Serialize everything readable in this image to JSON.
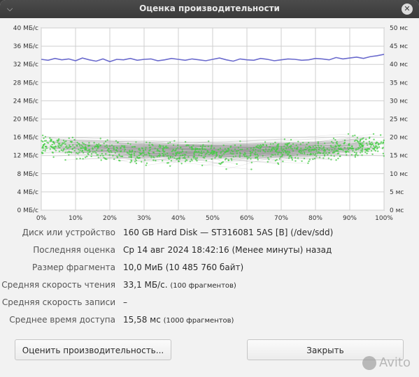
{
  "window": {
    "title": "Оценка производительности",
    "menu_icon": "chevron-down-icon",
    "close_icon": "close-icon"
  },
  "chart_data": {
    "type": "line",
    "x_ticks": [
      "0%",
      "10%",
      "20%",
      "30%",
      "40%",
      "50%",
      "60%",
      "70%",
      "80%",
      "90%",
      "100%"
    ],
    "y_left_ticks": [
      "0 МБ/с",
      "4 МБ/с",
      "8 МБ/с",
      "12 МБ/с",
      "16 МБ/с",
      "20 МБ/с",
      "24 МБ/с",
      "28 МБ/с",
      "32 МБ/с",
      "36 МБ/с",
      "40 МБ/с"
    ],
    "y_right_ticks": [
      "0 мс",
      "5 мс",
      "10 мс",
      "15 мс",
      "20 мс",
      "25 мс",
      "30 мс",
      "35 мс",
      "40 мс",
      "45 мс",
      "50 мс"
    ],
    "y_left_range": [
      0,
      40
    ],
    "y_right_range": [
      0,
      50
    ],
    "x_range": [
      0,
      100
    ],
    "grid": true,
    "read_rate_series": {
      "color": "#6a6acd",
      "x": [
        0,
        2,
        4,
        6,
        8,
        10,
        12,
        14,
        16,
        18,
        20,
        22,
        24,
        26,
        28,
        30,
        32,
        34,
        36,
        38,
        40,
        42,
        44,
        46,
        48,
        50,
        52,
        54,
        56,
        58,
        60,
        62,
        64,
        66,
        68,
        70,
        72,
        74,
        76,
        78,
        80,
        82,
        84,
        86,
        88,
        90,
        92,
        94,
        96,
        98,
        100
      ],
      "y": [
        33.1,
        32.9,
        33.3,
        33.0,
        33.2,
        32.8,
        33.4,
        33.0,
        32.7,
        33.2,
        32.6,
        33.1,
        33.0,
        33.3,
        32.9,
        33.1,
        33.2,
        32.8,
        33.0,
        33.3,
        33.1,
        32.9,
        33.2,
        33.0,
        32.8,
        33.1,
        33.4,
        33.0,
        32.7,
        33.2,
        33.0,
        32.9,
        33.3,
        33.1,
        32.8,
        33.0,
        33.2,
        33.1,
        32.9,
        33.0,
        33.3,
        33.2,
        33.0,
        33.5,
        33.2,
        33.4,
        33.6,
        33.3,
        33.7,
        33.9,
        34.2
      ]
    },
    "access_time_color": "#44cc44",
    "access_time_approx_mean_ms": 15.58
  },
  "info": {
    "rows": [
      {
        "label": "Диск или устройство",
        "value": "160 GB Hard Disk — ST316081 5AS [В] (/dev/sdd)",
        "note": ""
      },
      {
        "label": "Последняя оценка",
        "value": "Ср 14 авг 2024 18:42:16 (Менее минуты) назад",
        "note": ""
      },
      {
        "label": "Размер фрагмента",
        "value": "10,0 МиБ (10 485 760 байт)",
        "note": ""
      },
      {
        "label": "Средняя скорость чтения",
        "value": "33,1 МБ/с.",
        "note": "(100 фрагментов)"
      },
      {
        "label": "Средняя скорость записи",
        "value": "–",
        "note": ""
      },
      {
        "label": "Среднее время доступа",
        "value": "15,58 мс",
        "note": "(1000 фрагментов)"
      }
    ]
  },
  "buttons": {
    "benchmark": "Оценить производительность...",
    "close": "Закрыть"
  },
  "watermark": "Avito"
}
